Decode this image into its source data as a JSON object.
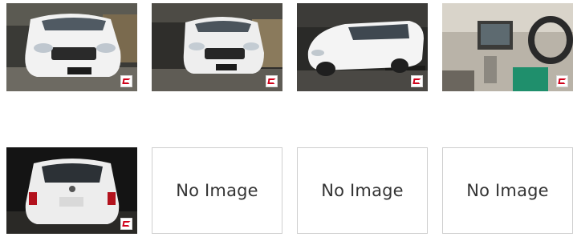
{
  "gallery": {
    "photos": [
      {
        "icon": "source-badge-icon",
        "subject": "car-front"
      },
      {
        "icon": "source-badge-icon",
        "subject": "car-front-angled"
      },
      {
        "icon": "source-badge-icon",
        "subject": "car-side"
      },
      {
        "icon": "source-badge-icon",
        "subject": "car-interior"
      },
      {
        "icon": "source-badge-icon",
        "subject": "car-rear"
      }
    ],
    "placeholders": [
      {
        "label": "No Image"
      },
      {
        "label": "No Image"
      },
      {
        "label": "No Image"
      }
    ]
  },
  "colors": {
    "badge_accent": "#d0021b",
    "placeholder_border": "#cfcfcf",
    "placeholder_text": "#333333"
  }
}
